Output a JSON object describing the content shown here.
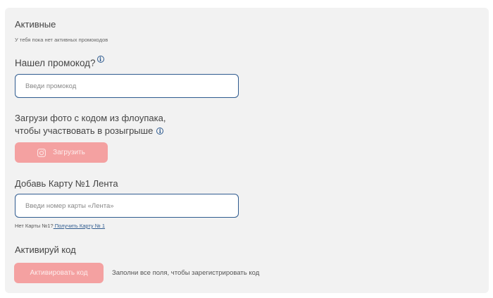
{
  "active": {
    "title": "Активные",
    "empty_note": "У тебя пока нет активных промокодов"
  },
  "promo": {
    "title": "Нашел промокод?",
    "info_icon": "i",
    "placeholder": "Введи промокод"
  },
  "upload": {
    "line1": "Загрузи фото с кодом из флоупака,",
    "line2": "чтобы участвовать в розыгрыше",
    "info_icon": "i",
    "button_label": "Загрузить"
  },
  "card": {
    "title": "Добавь Карту №1 Лента",
    "placeholder": "Введи номер карты «Лента»",
    "note_prefix": "Нет Карты №1?",
    "note_link": " Получить Карту № 1"
  },
  "activate": {
    "title": "Активируй код",
    "button_label": "Активировать код",
    "hint": "Заполни все поля, чтобы зарегистрировать код"
  },
  "colors": {
    "panel_bg": "#f2f2f2",
    "accent_blue": "#2f5b8f",
    "button_pink": "#f4a1a1"
  }
}
